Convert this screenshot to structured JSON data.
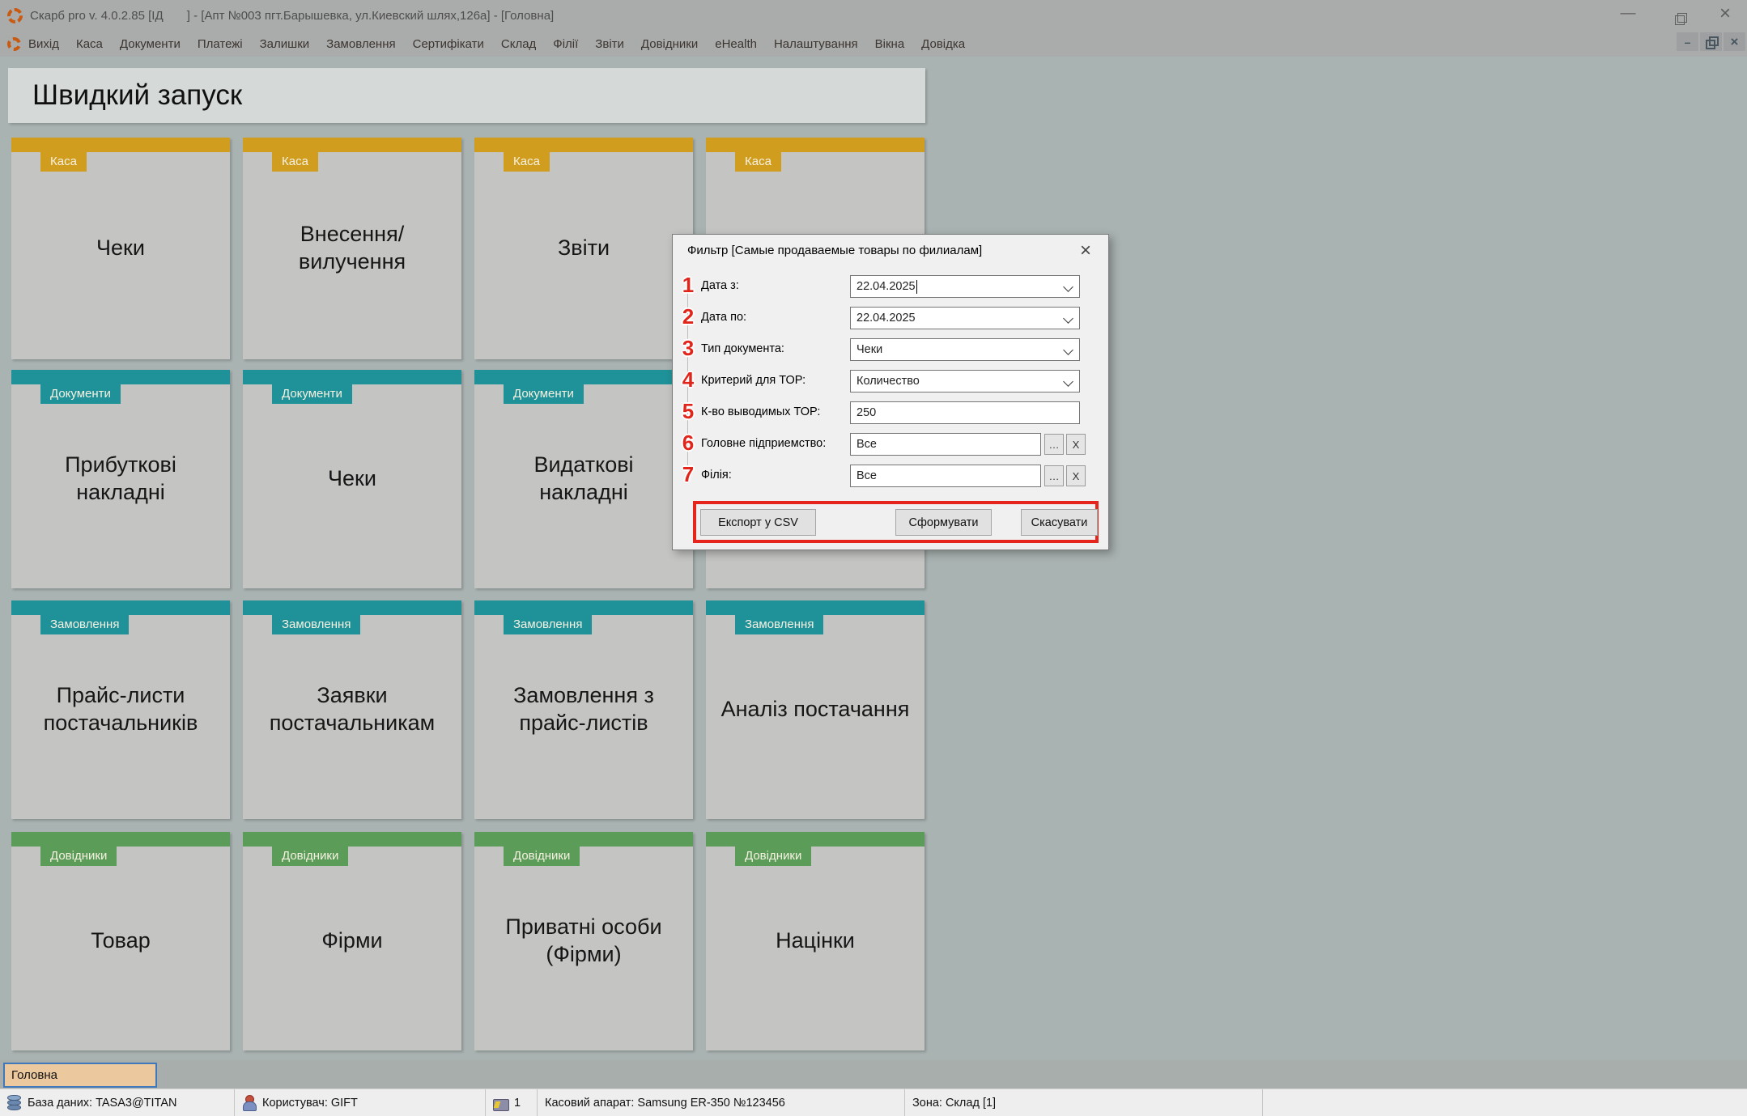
{
  "window": {
    "title": "Скарб pro v. 4.0.2.85 [ІД       ] - [Апт №003 пгт.Барышевка, ул.Киевский шлях,126а] - [Головна]",
    "controls": {
      "minimize": "—",
      "close": "×"
    },
    "mdi_controls": {
      "minimize": "–",
      "close": "×"
    }
  },
  "menu": {
    "items": [
      "Вихід",
      "Каса",
      "Документи",
      "Платежі",
      "Залишки",
      "Замовлення",
      "Сертифікати",
      "Склад",
      "Філії",
      "Звіти",
      "Довідники",
      "eHealth",
      "Налаштування",
      "Вікна",
      "Довідка"
    ]
  },
  "quick_launch": {
    "title": "Швидкий запуск",
    "rows": [
      {
        "category": "Каса",
        "color": "gold",
        "tiles": [
          "Чеки",
          "Внесення/вилучення",
          "Звіти",
          ""
        ]
      },
      {
        "category": "Документи",
        "color": "teal",
        "tiles": [
          "Прибуткові накладні",
          "Чеки",
          "Видаткові накладні",
          ""
        ]
      },
      {
        "category": "Замовлення",
        "color": "teal",
        "tiles": [
          "Прайс-листи постачальників",
          "Заявки постачальникам",
          "Замовлення з прайс-листів",
          "Аналіз постачання"
        ]
      },
      {
        "category": "Довідники",
        "color": "green",
        "tiles": [
          "Товар",
          "Фірми",
          "Приватні особи (Фірми)",
          "Націнки"
        ]
      }
    ]
  },
  "dialog": {
    "title": "Фильтр [Самые продаваемые товары по филиалам]",
    "close_glyph": "×",
    "fields": [
      {
        "num": "1",
        "label": "Дата з:",
        "value": "22.04.2025"
      },
      {
        "num": "2",
        "label": "Дата по:",
        "value": "22.04.2025"
      },
      {
        "num": "3",
        "label": "Тип документа:",
        "value": "Чеки"
      },
      {
        "num": "4",
        "label": "Критерий для ТОР:",
        "value": "Количество"
      },
      {
        "num": "5",
        "label": "К-во выводимых ТОР:",
        "value": "250"
      },
      {
        "num": "6",
        "label": "Головне підприемство:",
        "value": "Все",
        "browse": "…",
        "clear": "X"
      },
      {
        "num": "7",
        "label": "Філія:",
        "value": "Все",
        "browse": "…",
        "clear": "X"
      }
    ],
    "buttons": {
      "export": "Експорт у CSV",
      "generate": "Сформувати",
      "cancel": "Скасувати"
    }
  },
  "tabs": {
    "main": "Головна"
  },
  "status_bar": {
    "database": "База даних: TASA3@TITAN",
    "user": "Користувач: GIFT",
    "cash_count": "1",
    "cash_register": "Касовий апарат: Samsung ER-350 №123456",
    "zone": "Зона: Склад [1]"
  },
  "colors": {
    "category_gold": "#d09d1e",
    "category_teal": "#1f9198",
    "category_green": "#5c9c59",
    "annotation_red": "#e5251b",
    "tab_fill": "#ebc89e",
    "tab_border": "#4079bb",
    "mdi_background": "#a9b3b1"
  }
}
